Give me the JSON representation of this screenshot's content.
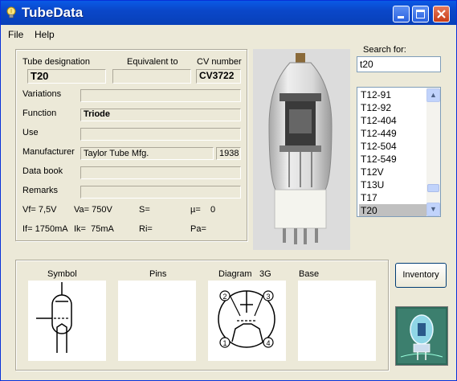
{
  "window": {
    "title": "TubeData",
    "title_icon": "bulb-icon",
    "controls": [
      "minimize-icon",
      "maximize-icon",
      "close-icon"
    ]
  },
  "menu": {
    "file": "File",
    "help": "Help"
  },
  "form": {
    "tube_designation_label": "Tube designation",
    "tube_designation": "T20",
    "equivalent_label": "Equivalent to",
    "equivalent": "",
    "cv_label": "CV number",
    "cv": "CV3722",
    "variations_label": "Variations",
    "variations": "",
    "function_label": "Function",
    "function": "Triode",
    "use_label": "Use",
    "use": "",
    "manufacturer_label": "Manufacturer",
    "manufacturer": "Taylor Tube Mfg.",
    "year": "1938",
    "databook_label": "Data book",
    "databook": "",
    "remarks_label": "Remarks",
    "remarks": ""
  },
  "params": {
    "vf": "Vf= 7,5V",
    "va": "Va= 750V",
    "s": "S=",
    "mu": "µ=    0",
    "if": "If= 1750mA",
    "ik": "Ik=  75mA",
    "ri": "Ri=",
    "pa": "Pa="
  },
  "search": {
    "label": "Search for:",
    "value": "t20",
    "results": [
      "T12-91",
      "T12-92",
      "T12-404",
      "T12-449",
      "T12-504",
      "T12-549",
      "T12V",
      "T13U",
      "T17",
      "T20"
    ],
    "selected": "T20"
  },
  "bottom": {
    "symbol_label": "Symbol",
    "pins_label": "Pins",
    "diagram_label": "Diagram",
    "diagram_code": "3G",
    "base_label": "Base",
    "pin_numbers": [
      "1",
      "2",
      "3",
      "4"
    ]
  },
  "inventory_button": "Inventory",
  "images": {
    "tube_photo": "vacuum-tube-photo",
    "logo": "tube-logo-icon"
  },
  "colors": {
    "titlebar": "#0a47c9",
    "window_bg": "#ece9d8",
    "selection": "#c0c0c0"
  }
}
